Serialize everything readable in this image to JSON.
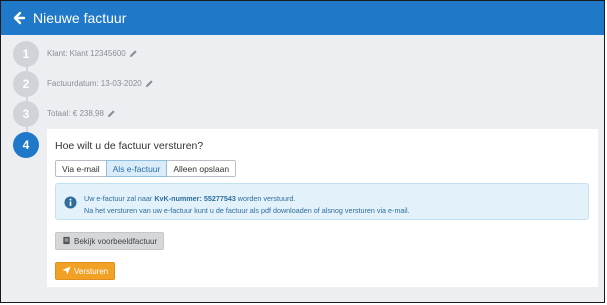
{
  "header": {
    "title": "Nieuwe factuur",
    "back_icon": "arrow-left-icon",
    "color": "#1f78c8"
  },
  "steps": [
    {
      "number": "1",
      "text": "Klant: Klant 12345600"
    },
    {
      "number": "2",
      "text": "Factuurdatum: 13-03-2020"
    },
    {
      "number": "3",
      "text": "Totaal: € 238,98"
    },
    {
      "number": "4",
      "text": "Hoe wilt u de factuur versturen?"
    }
  ],
  "send_options": {
    "items": [
      "Via e-mail",
      "Als e-factuur",
      "Alleen opslaan"
    ],
    "selected": "Als e-factuur"
  },
  "info": {
    "line1_prefix": "Uw e-factuur zal naar ",
    "line1_bold": "KvK-nummer: 55277543",
    "line1_suffix": " worden verstuurd.",
    "line2": "Na het versturen van uw e-factuur kunt u de factuur als pdf downloaden of alsnog versturen via e-mail."
  },
  "buttons": {
    "preview_label": "Bekijk voorbeeldfactuur",
    "send_label": "Versturen"
  },
  "colors": {
    "accent": "#1f78c8",
    "send_button": "#f1a124",
    "info_bg": "#e3f1fa"
  }
}
